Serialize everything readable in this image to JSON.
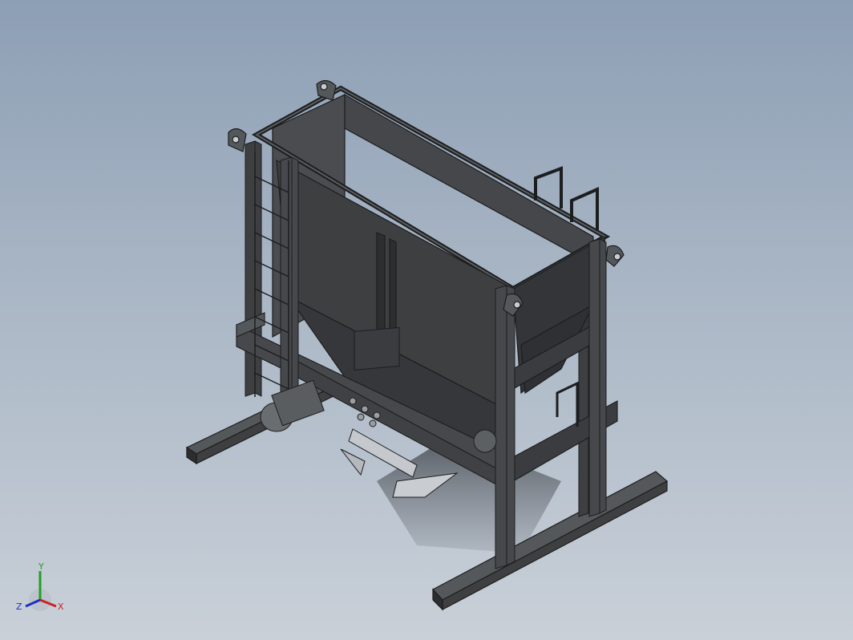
{
  "viewport": {
    "background_top": "#8d9fb5",
    "background_bottom": "#c9d0d8",
    "model_color": "#3d3f41",
    "model_edge_color": "#1c1d1e"
  },
  "triad": {
    "x_label": "X",
    "y_label": "Y",
    "z_label": "Z",
    "x_color": "#d02020",
    "y_color": "#20a020",
    "z_color": "#2030c0"
  }
}
